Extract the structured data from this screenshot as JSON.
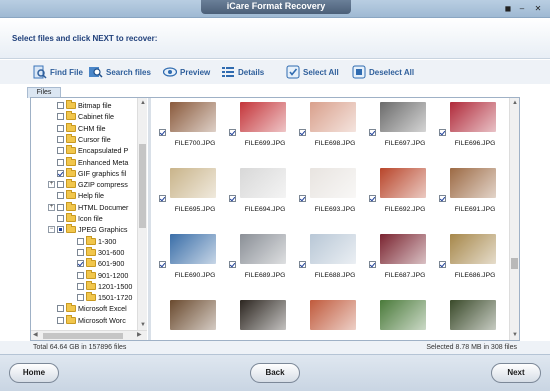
{
  "window": {
    "title": "iCare Format Recovery",
    "controls": [
      "◼",
      "–",
      "✕"
    ]
  },
  "header": {
    "instruction": "Select files and click NEXT to recover:"
  },
  "toolbar": {
    "find_file": "Find File",
    "search_files": "Search files",
    "preview": "Preview",
    "details": "Details",
    "select_all": "Select All",
    "deselect_all": "Deselect All"
  },
  "files_tab": "Files",
  "tree": [
    {
      "label": "Bitmap file",
      "check": "off",
      "indent": 0,
      "expander": ""
    },
    {
      "label": "Cabinet file",
      "check": "off",
      "indent": 0,
      "expander": ""
    },
    {
      "label": "CHM file",
      "check": "off",
      "indent": 0,
      "expander": ""
    },
    {
      "label": "Cursor file",
      "check": "off",
      "indent": 0,
      "expander": ""
    },
    {
      "label": "Encapsulated P",
      "check": "off",
      "indent": 0,
      "expander": ""
    },
    {
      "label": "Enhanced Meta",
      "check": "off",
      "indent": 0,
      "expander": ""
    },
    {
      "label": "GIF graphics fil",
      "check": "on",
      "indent": 0,
      "expander": ""
    },
    {
      "label": "GZIP compress",
      "check": "off",
      "indent": 0,
      "expander": "+"
    },
    {
      "label": "Help file",
      "check": "off",
      "indent": 0,
      "expander": ""
    },
    {
      "label": "HTML Documer",
      "check": "off",
      "indent": 0,
      "expander": "+"
    },
    {
      "label": "Icon file",
      "check": "off",
      "indent": 0,
      "expander": ""
    },
    {
      "label": "JPEG Graphics",
      "check": "partial",
      "indent": 0,
      "expander": "−"
    },
    {
      "label": "1-300",
      "check": "off",
      "indent": 1,
      "expander": ""
    },
    {
      "label": "301-600",
      "check": "off",
      "indent": 1,
      "expander": ""
    },
    {
      "label": "601-900",
      "check": "on",
      "indent": 1,
      "expander": ""
    },
    {
      "label": "901-1200",
      "check": "off",
      "indent": 1,
      "expander": ""
    },
    {
      "label": "1201-1500",
      "check": "off",
      "indent": 1,
      "expander": ""
    },
    {
      "label": "1501-1720",
      "check": "off",
      "indent": 1,
      "expander": ""
    },
    {
      "label": "Microsoft Excel",
      "check": "off",
      "indent": 0,
      "expander": ""
    },
    {
      "label": "Microsoft Worc",
      "check": "off",
      "indent": 0,
      "expander": ""
    }
  ],
  "files": [
    {
      "name": "FILE700.JPG",
      "color": "#8a5a3c"
    },
    {
      "name": "FILE699.JPG",
      "color": "#c4353a"
    },
    {
      "name": "FILE698.JPG",
      "color": "#d9a08c"
    },
    {
      "name": "FILE697.JPG",
      "color": "#6b6b6b"
    },
    {
      "name": "FILE696.JPG",
      "color": "#b02a3a"
    },
    {
      "name": "FILE695.JPG",
      "color": "#c9b48a"
    },
    {
      "name": "FILE694.JPG",
      "color": "#d8d8d8"
    },
    {
      "name": "FILE693.JPG",
      "color": "#e8e4e0"
    },
    {
      "name": "FILE692.JPG",
      "color": "#b8452a"
    },
    {
      "name": "FILE691.JPG",
      "color": "#9c6a44"
    },
    {
      "name": "FILE690.JPG",
      "color": "#3a6ea8"
    },
    {
      "name": "FILE689.JPG",
      "color": "#8a8f96"
    },
    {
      "name": "FILE688.JPG",
      "color": "#b8c7d6"
    },
    {
      "name": "FILE687.JPG",
      "color": "#7a2430"
    },
    {
      "name": "FILE686.JPG",
      "color": "#a6874a"
    },
    {
      "name": "",
      "color": "#6a4a2e"
    },
    {
      "name": "",
      "color": "#2c2620"
    },
    {
      "name": "",
      "color": "#c05a3c"
    },
    {
      "name": "",
      "color": "#4a7a3a"
    },
    {
      "name": "",
      "color": "#3a4a2a"
    }
  ],
  "status": {
    "total": "Total 64.64 GB in 157896 files",
    "selected": "Selected 8.78 MB in 308 files"
  },
  "footer": {
    "home": "Home",
    "back": "Back",
    "next": "Next"
  },
  "colors": {
    "accent": "#2f5f9b",
    "instruction": "#1f3f7a"
  }
}
